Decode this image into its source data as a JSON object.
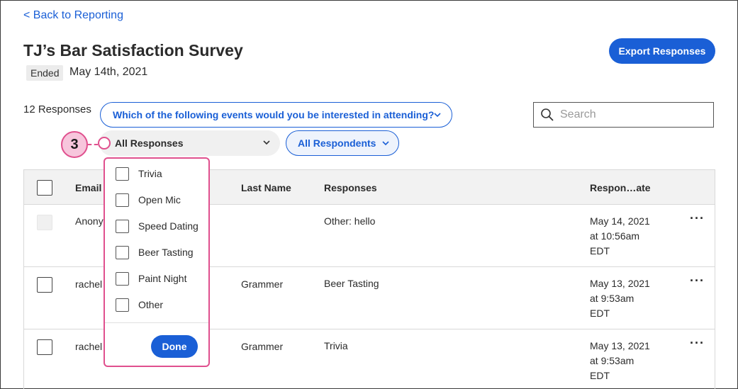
{
  "back_link": "< Back to Reporting",
  "survey": {
    "title": "TJ’s Bar Satisfaction Survey",
    "status": "Ended",
    "date": "May 14th, 2021"
  },
  "export_button": "Export Responses",
  "response_count": "12 Responses",
  "question_filter": "Which of the following events would you be interested in attending?",
  "search": {
    "placeholder": "Search"
  },
  "responses_filter": "All Responses",
  "respondents_filter": "All Respondents",
  "step_number": "3",
  "table": {
    "headers": {
      "email": "Email",
      "last_name": "Last Name",
      "responses": "Responses",
      "response_date": "Respon…ate"
    },
    "rows": [
      {
        "email": "Anony",
        "last_name": "",
        "response": "Other: hello",
        "date_line1": "May 14, 2021",
        "date_line2": "at 10:56am",
        "date_line3": "EDT",
        "more": "···"
      },
      {
        "email": "rachel",
        "last_name": "Grammer",
        "response": "Beer Tasting",
        "date_line1": "May 13, 2021",
        "date_line2": "at 9:53am",
        "date_line3": "EDT",
        "more": "···"
      },
      {
        "email": "rachel",
        "last_name": "Grammer",
        "response": "Trivia",
        "date_line1": "May 13, 2021",
        "date_line2": "at 9:53am",
        "date_line3": "EDT",
        "more": "···"
      }
    ]
  },
  "dropdown": {
    "options": [
      "Trivia",
      "Open Mic",
      "Speed Dating",
      "Beer Tasting",
      "Paint Night",
      "Other"
    ],
    "done": "Done"
  },
  "colors": {
    "accent": "#1a5fd6",
    "highlight": "#e0508e"
  }
}
